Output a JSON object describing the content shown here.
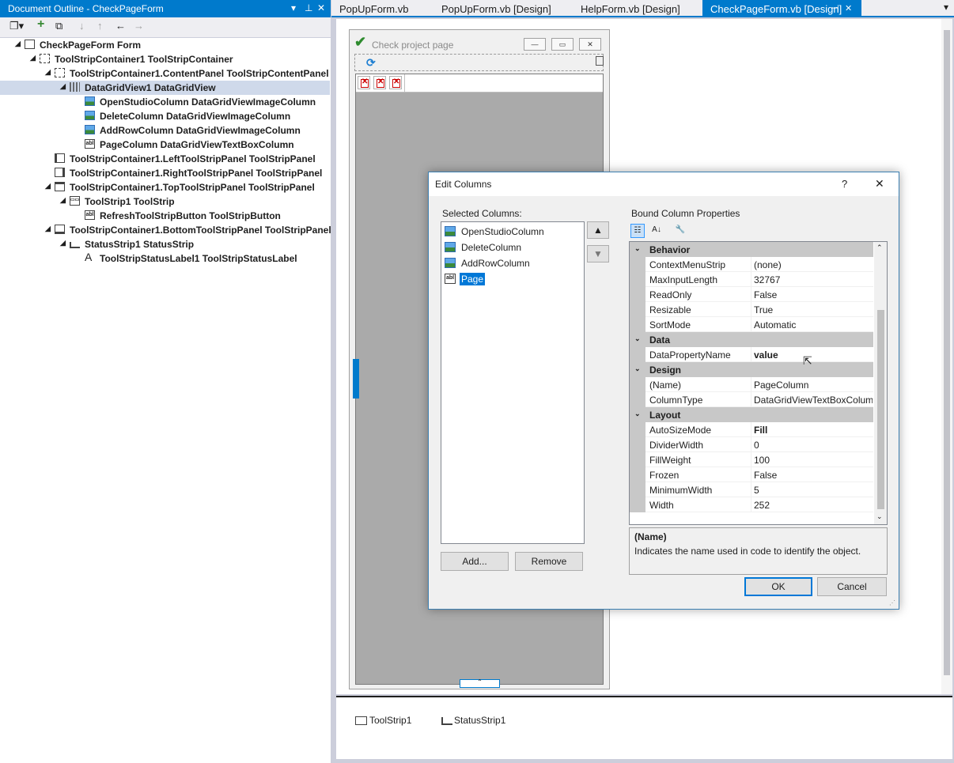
{
  "outline": {
    "title": "Document Outline - CheckPageForm",
    "pin_glyph": "▾",
    "pin2_glyph": "⊥",
    "close_glyph": "✕",
    "tree": [
      {
        "label": "CheckPageForm  Form",
        "icon": "form-icon",
        "level": 0,
        "expanded": true
      },
      {
        "label": "ToolStripContainer1  ToolStripContainer",
        "icon": "container-icon",
        "level": 1,
        "expanded": true
      },
      {
        "label": "ToolStripContainer1.ContentPanel  ToolStripContentPanel",
        "icon": "content-panel-icon",
        "level": 2,
        "expanded": true
      },
      {
        "label": "DataGridView1  DataGridView",
        "icon": "datagrid-icon",
        "level": 3,
        "expanded": true,
        "selected": true
      },
      {
        "label": "OpenStudioColumn  DataGridViewImageColumn",
        "icon": "image-column-icon",
        "level": 4
      },
      {
        "label": "DeleteColumn  DataGridViewImageColumn",
        "icon": "image-column-icon",
        "level": 4
      },
      {
        "label": "AddRowColumn  DataGridViewImageColumn",
        "icon": "image-column-icon",
        "level": 4
      },
      {
        "label": "PageColumn  DataGridViewTextBoxColumn",
        "icon": "textbox-column-icon",
        "level": 4
      },
      {
        "label": "ToolStripContainer1.LeftToolStripPanel  ToolStripPanel",
        "icon": "left-panel-icon",
        "level": 2
      },
      {
        "label": "ToolStripContainer1.RightToolStripPanel  ToolStripPanel",
        "icon": "right-panel-icon",
        "level": 2
      },
      {
        "label": "ToolStripContainer1.TopToolStripPanel  ToolStripPanel",
        "icon": "top-panel-icon",
        "level": 2,
        "expanded": true
      },
      {
        "label": "ToolStrip1  ToolStrip",
        "icon": "toolstrip-icon",
        "level": 3,
        "expanded": true
      },
      {
        "label": "RefreshToolStripButton  ToolStripButton",
        "icon": "textbox-column-icon",
        "level": 4
      },
      {
        "label": "ToolStripContainer1.BottomToolStripPanel  ToolStripPanel",
        "icon": "bottom-panel-icon",
        "level": 2,
        "expanded": true
      },
      {
        "label": "StatusStrip1  StatusStrip",
        "icon": "statusstrip-icon",
        "level": 3,
        "expanded": true
      },
      {
        "label": "ToolStripStatusLabel1  ToolStripStatusLabel",
        "icon": "label-icon",
        "level": 4
      }
    ]
  },
  "tabs": [
    {
      "label": "PopUpForm.vb"
    },
    {
      "label": "PopUpForm.vb [Design]"
    },
    {
      "label": "HelpForm.vb [Design]"
    },
    {
      "label": "CheckPageForm.vb [Design]",
      "active": true
    }
  ],
  "tab_pin_glyph": "⊣",
  "tab_close_glyph": "✕",
  "tab_dropdown_glyph": "▾",
  "form": {
    "title": "Check project page",
    "minimize_glyph": "—",
    "maximize_glyph": "▭",
    "close_glyph": "✕"
  },
  "tray": {
    "items": [
      {
        "label": "ToolStrip1",
        "icon": "toolstrip-icon"
      },
      {
        "label": "StatusStrip1",
        "icon": "statusstrip-icon"
      }
    ]
  },
  "dialog": {
    "title": "Edit Columns",
    "help_glyph": "?",
    "close_glyph": "✕",
    "selected_columns_label": "Selected Columns:",
    "columns": [
      {
        "label": "OpenStudioColumn",
        "icon": "image-column-icon"
      },
      {
        "label": "DeleteColumn",
        "icon": "image-column-icon"
      },
      {
        "label": "AddRowColumn",
        "icon": "image-column-icon"
      },
      {
        "label": "Page",
        "icon": "textbox-column-icon",
        "selected": true
      }
    ],
    "move_up_glyph": "🠅",
    "move_down_glyph": "🠇",
    "add_label": "Add...",
    "remove_label": "Remove",
    "bound_props_label": "Bound Column Properties",
    "categories": [
      {
        "name": "Behavior",
        "rows": [
          {
            "name": "ContextMenuStrip",
            "value": "(none)"
          },
          {
            "name": "MaxInputLength",
            "value": "32767"
          },
          {
            "name": "ReadOnly",
            "value": "False"
          },
          {
            "name": "Resizable",
            "value": "True"
          },
          {
            "name": "SortMode",
            "value": "Automatic"
          }
        ]
      },
      {
        "name": "Data",
        "rows": [
          {
            "name": "DataPropertyName",
            "value": "value",
            "bold": true
          }
        ]
      },
      {
        "name": "Design",
        "rows": [
          {
            "name": "(Name)",
            "value": "PageColumn"
          },
          {
            "name": "ColumnType",
            "value": "DataGridViewTextBoxColumn"
          }
        ]
      },
      {
        "name": "Layout",
        "rows": [
          {
            "name": "AutoSizeMode",
            "value": "Fill",
            "bold": true
          },
          {
            "name": "DividerWidth",
            "value": "0"
          },
          {
            "name": "FillWeight",
            "value": "100"
          },
          {
            "name": "Frozen",
            "value": "False"
          },
          {
            "name": "MinimumWidth",
            "value": "5"
          },
          {
            "name": "Width",
            "value": "252"
          }
        ]
      }
    ],
    "description_title": "(Name)",
    "description_text": "Indicates the name used in code to identify the object.",
    "ok_label": "OK",
    "cancel_label": "Cancel"
  },
  "colors": {
    "accent": "#007acc",
    "selection": "#0078d7",
    "tree_selection": "#cfd9ea"
  }
}
